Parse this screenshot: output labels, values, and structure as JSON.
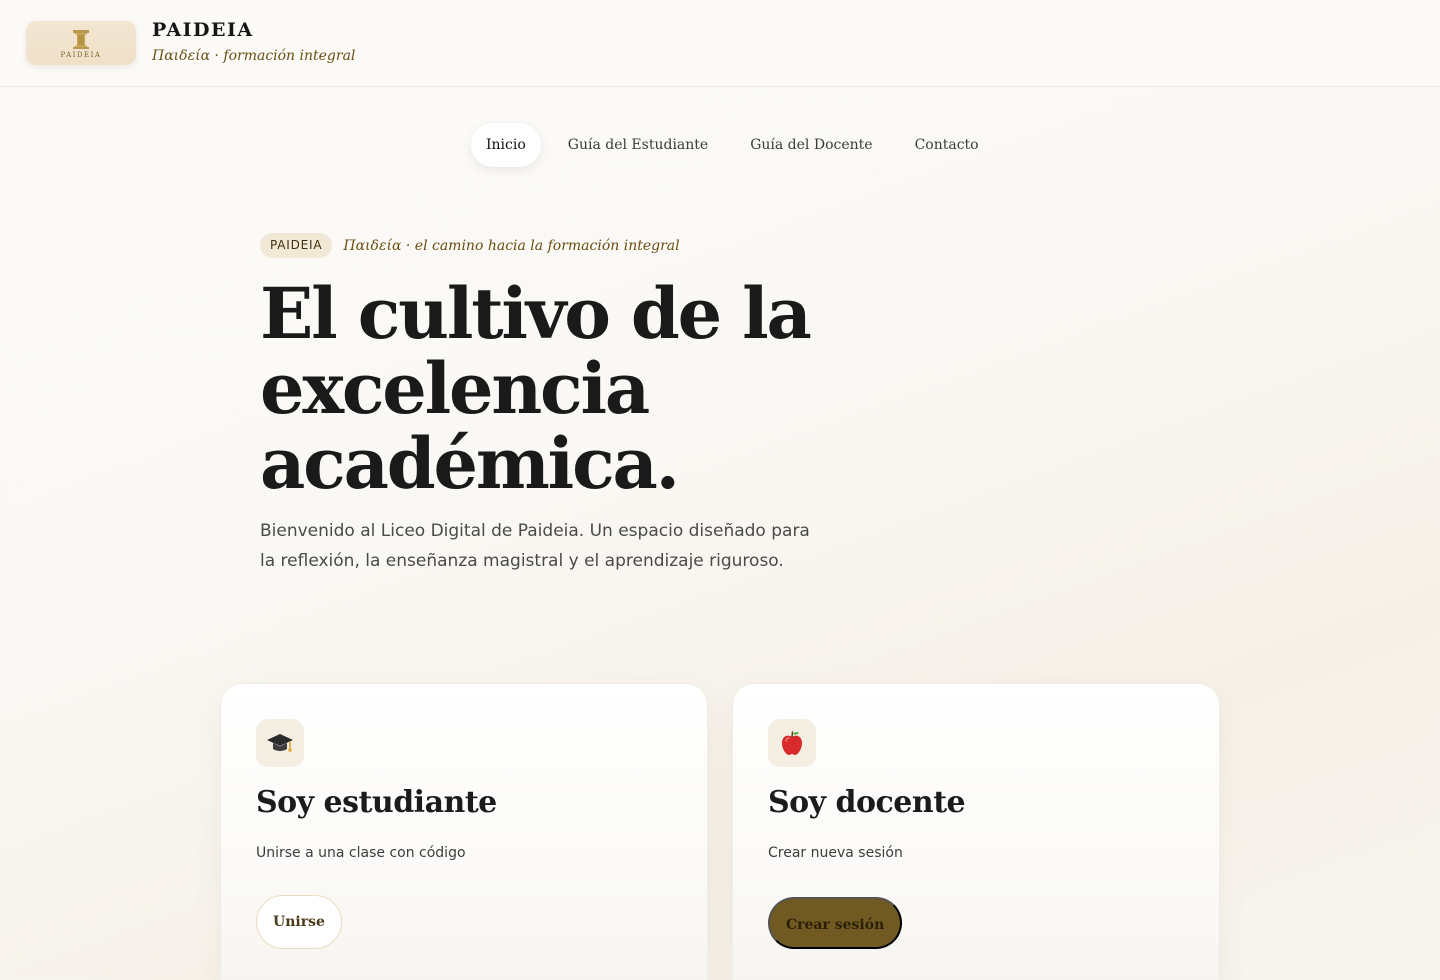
{
  "header": {
    "logo_text": "PAIDEIA",
    "brand_name": "PAIDEIA",
    "brand_tagline": "Παιδεία · formación integral"
  },
  "nav": {
    "items": [
      {
        "label": "Inicio",
        "active": true
      },
      {
        "label": "Guía del Estudiante",
        "active": false
      },
      {
        "label": "Guía del Docente",
        "active": false
      },
      {
        "label": "Contacto",
        "active": false
      }
    ]
  },
  "hero": {
    "pill": "PAIDEIA",
    "eyebrow": "Παιδεία · el camino hacia la formación integral",
    "title_lines": [
      "El cultivo de la",
      "excelencia",
      "académica."
    ],
    "subtitle": "Bienvenido al Liceo Digital de Paideia. Un espacio diseñado para la reflexión, la enseñanza magistral y el aprendizaje riguroso."
  },
  "cards": [
    {
      "icon": "graduation-cap-icon",
      "title": "Soy estudiante",
      "description": "Unirse a una clase con código",
      "button_label": "Unirse"
    },
    {
      "icon": "apple-icon",
      "title": "Soy docente",
      "description": "Crear nueva sesión",
      "button_label": "Crear sesión"
    }
  ],
  "colors": {
    "accent": "#715a21",
    "accent_text": "#6a4e12",
    "pill_bg": "#f1e8d6",
    "background": "#faf8f4"
  }
}
